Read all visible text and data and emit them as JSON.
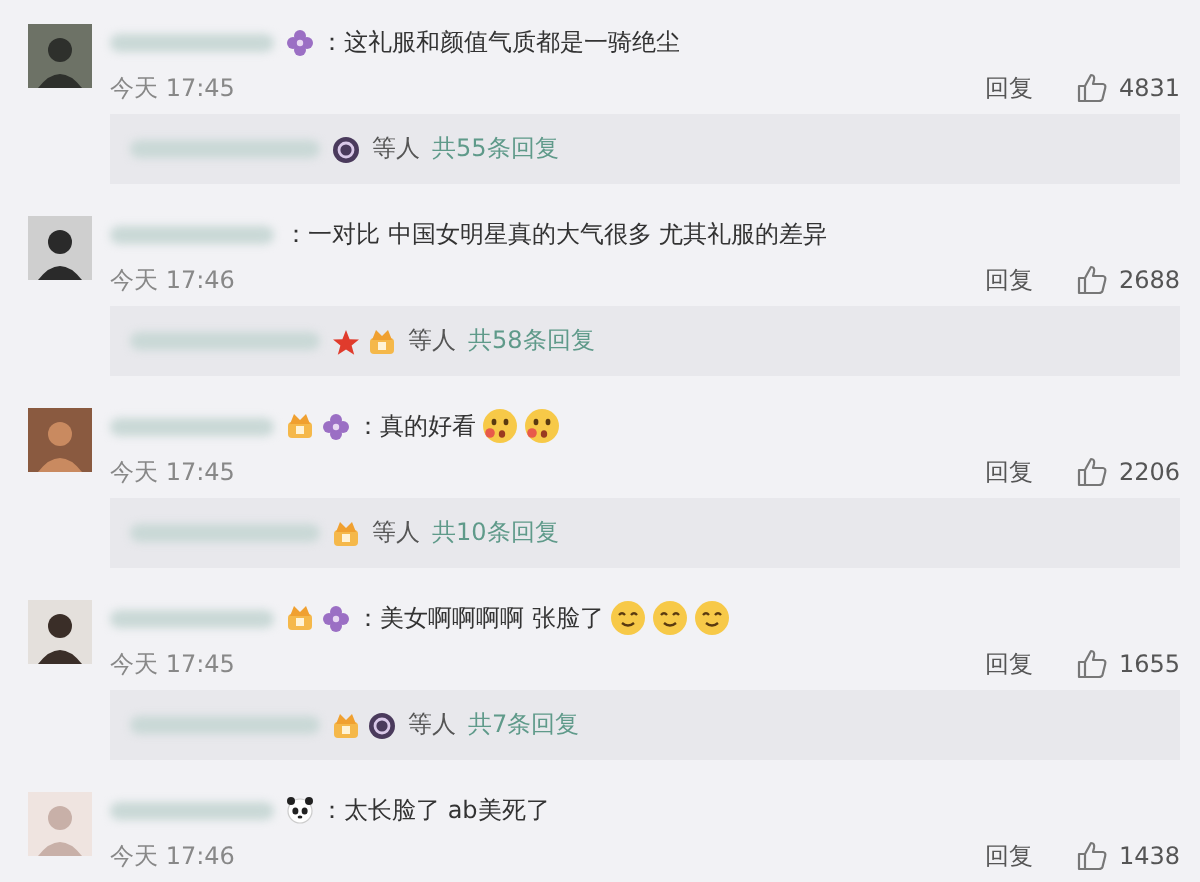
{
  "comments": [
    {
      "name_badges": [
        {
          "kind": "flower"
        }
      ],
      "text": "：这礼服和颜值气质都是一骑绝尘",
      "time": "今天 17:45",
      "reply": "回复",
      "likes": "4831",
      "thread": {
        "badges": [
          {
            "kind": "medal"
          }
        ],
        "others": "等人",
        "count": "共55条回复"
      }
    },
    {
      "text": "：一对比  中国女明星真的大气很多  尤其礼服的差异",
      "time": "今天 17:46",
      "reply": "回复",
      "likes": "2688",
      "thread": {
        "badges": [
          {
            "kind": "star"
          },
          {
            "kind": "crown"
          }
        ],
        "others": "等人",
        "count": "共58条回复"
      }
    },
    {
      "name_badges": [
        {
          "kind": "crown"
        },
        {
          "kind": "flower"
        }
      ],
      "text": "：真的好看",
      "emojis": [
        {
          "kind": "surprised"
        },
        {
          "kind": "surprised"
        }
      ],
      "time": "今天 17:45",
      "reply": "回复",
      "likes": "2206",
      "thread": {
        "badges": [
          {
            "kind": "crown"
          }
        ],
        "others": "等人",
        "count": "共10条回复"
      }
    },
    {
      "name_badges": [
        {
          "kind": "crown"
        },
        {
          "kind": "flower"
        }
      ],
      "text": "：美女啊啊啊啊 张脸了",
      "emojis": [
        {
          "kind": "smile"
        },
        {
          "kind": "smile"
        },
        {
          "kind": "smile"
        }
      ],
      "time": "今天 17:45",
      "reply": "回复",
      "likes": "1655",
      "thread": {
        "badges": [
          {
            "kind": "crown"
          },
          {
            "kind": "medal"
          }
        ],
        "others": "等人",
        "count": "共7条回复"
      }
    },
    {
      "name_badges": [
        {
          "kind": "panda"
        }
      ],
      "text": "：太长脸了  ab美死了",
      "time": "今天 17:46",
      "reply": "回复",
      "likes": "1438"
    }
  ]
}
